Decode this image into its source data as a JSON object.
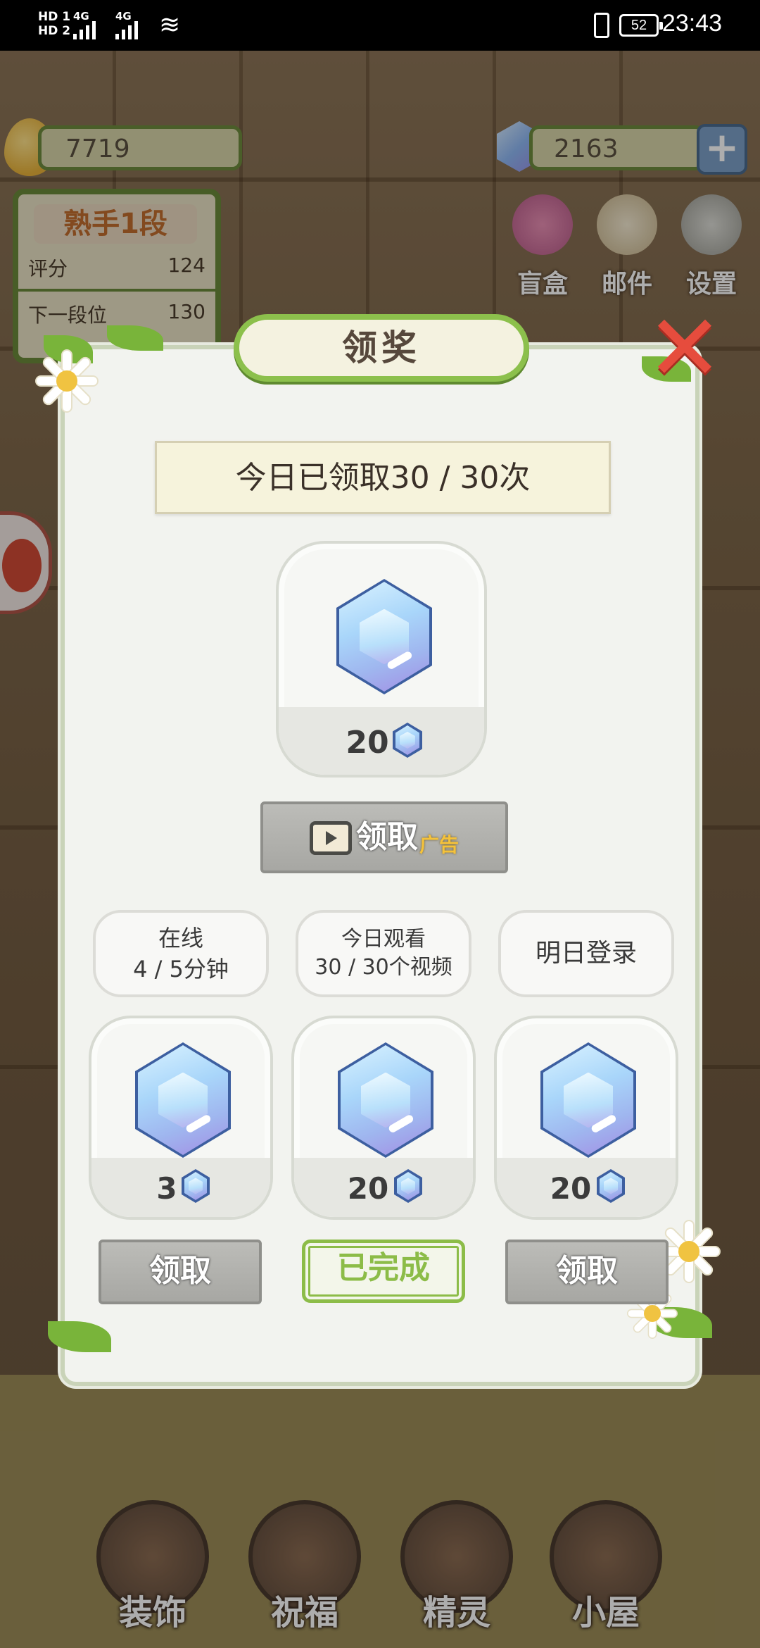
{
  "status_bar": {
    "sim1": "HD 1",
    "sim2": "HD 2",
    "net1": "4G",
    "net2": "4G",
    "battery": "52",
    "time": "23:43"
  },
  "hud": {
    "coins": "7719",
    "gems": "2163",
    "plus_label": "+",
    "rank": {
      "title": "熟手1段",
      "score_label": "评分",
      "score_value": "124",
      "next_label": "下一段位",
      "next_value": "130"
    },
    "top_icons": [
      {
        "label": "盲盒",
        "icon": "gift-box-icon"
      },
      {
        "label": "邮件",
        "icon": "mail-icon"
      },
      {
        "label": "设置",
        "icon": "gear-icon"
      }
    ]
  },
  "modal": {
    "title": "领奖",
    "close_label": "✕",
    "daily_status": "今日已领取30 / 30次",
    "main_reward": {
      "amount": "20",
      "icon": "gem-icon"
    },
    "ad_claim_button": {
      "label": "领取",
      "ad_tag": "广告",
      "icon": "tv-icon"
    },
    "tasks": [
      {
        "line1": "在线",
        "line2": "4 / 5分钟",
        "reward": "3",
        "button": "领取",
        "state": "claimable"
      },
      {
        "line1": "今日观看",
        "line2": "30 / 30个视频",
        "reward": "20",
        "button": "已完成",
        "state": "done"
      },
      {
        "line1": "明日登录",
        "line2": "",
        "reward": "20",
        "button": "领取",
        "state": "claimable"
      }
    ]
  },
  "bottom_nav": [
    {
      "label": "装饰",
      "icon": "plant-pot-icon"
    },
    {
      "label": "祝福",
      "icon": "fairy-icon"
    },
    {
      "label": "精灵",
      "icon": "elf-icon"
    },
    {
      "label": "小屋",
      "icon": "house-icon"
    }
  ],
  "colors": {
    "accent_green": "#8cbc48",
    "close_red": "#e64c3d",
    "gem_blue": "#a9d6fa",
    "gem_purple": "#a38de4"
  }
}
